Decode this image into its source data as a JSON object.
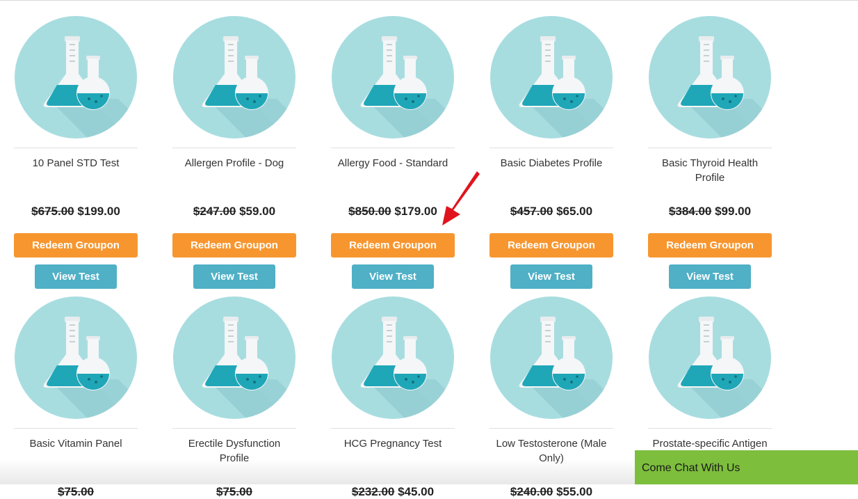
{
  "products": [
    {
      "name": "10 Panel STD Test",
      "old_price": "$675.00",
      "price": "$199.00",
      "redeem_label": "Redeem Groupon",
      "view_label": "View Test"
    },
    {
      "name": "Allergen Profile - Dog",
      "old_price": "$247.00",
      "price": "$59.00",
      "redeem_label": "Redeem Groupon",
      "view_label": "View Test"
    },
    {
      "name": "Allergy Food - Standard",
      "old_price": "$850.00",
      "price": "$179.00",
      "redeem_label": "Redeem Groupon",
      "view_label": "View Test"
    },
    {
      "name": "Basic Diabetes Profile",
      "old_price": "$457.00",
      "price": "$65.00",
      "redeem_label": "Redeem Groupon",
      "view_label": "View Test"
    },
    {
      "name": "Basic Thyroid Health Profile",
      "old_price": "$384.00",
      "price": "$99.00",
      "redeem_label": "Redeem Groupon",
      "view_label": "View Test"
    },
    {
      "name": "Basic Vitamin Panel",
      "old_price": "$75.00",
      "price": "",
      "redeem_label": "",
      "view_label": ""
    },
    {
      "name": "Erectile Dysfunction Profile",
      "old_price": "$75.00",
      "price": "",
      "redeem_label": "",
      "view_label": ""
    },
    {
      "name": "HCG Pregnancy Test",
      "old_price": "$232.00",
      "price": "$45.00",
      "redeem_label": "",
      "view_label": ""
    },
    {
      "name": "Low Testosterone (Male Only)",
      "old_price": "$240.00",
      "price": "$55.00",
      "redeem_label": "",
      "view_label": ""
    },
    {
      "name": "Prostate-specific Antigen (PSA)",
      "old_price": "",
      "price": "",
      "redeem_label": "",
      "view_label": ""
    }
  ],
  "chat": {
    "label": "Come Chat With Us"
  },
  "colors": {
    "redeem": "#f7962f",
    "view": "#4fb0c6",
    "icon_circle": "#a8dde0",
    "chat": "#7dbe3c",
    "arrow": "#e0141e"
  },
  "icons": {
    "product": "lab-flasks-icon",
    "annotation": "red-arrow-icon"
  }
}
